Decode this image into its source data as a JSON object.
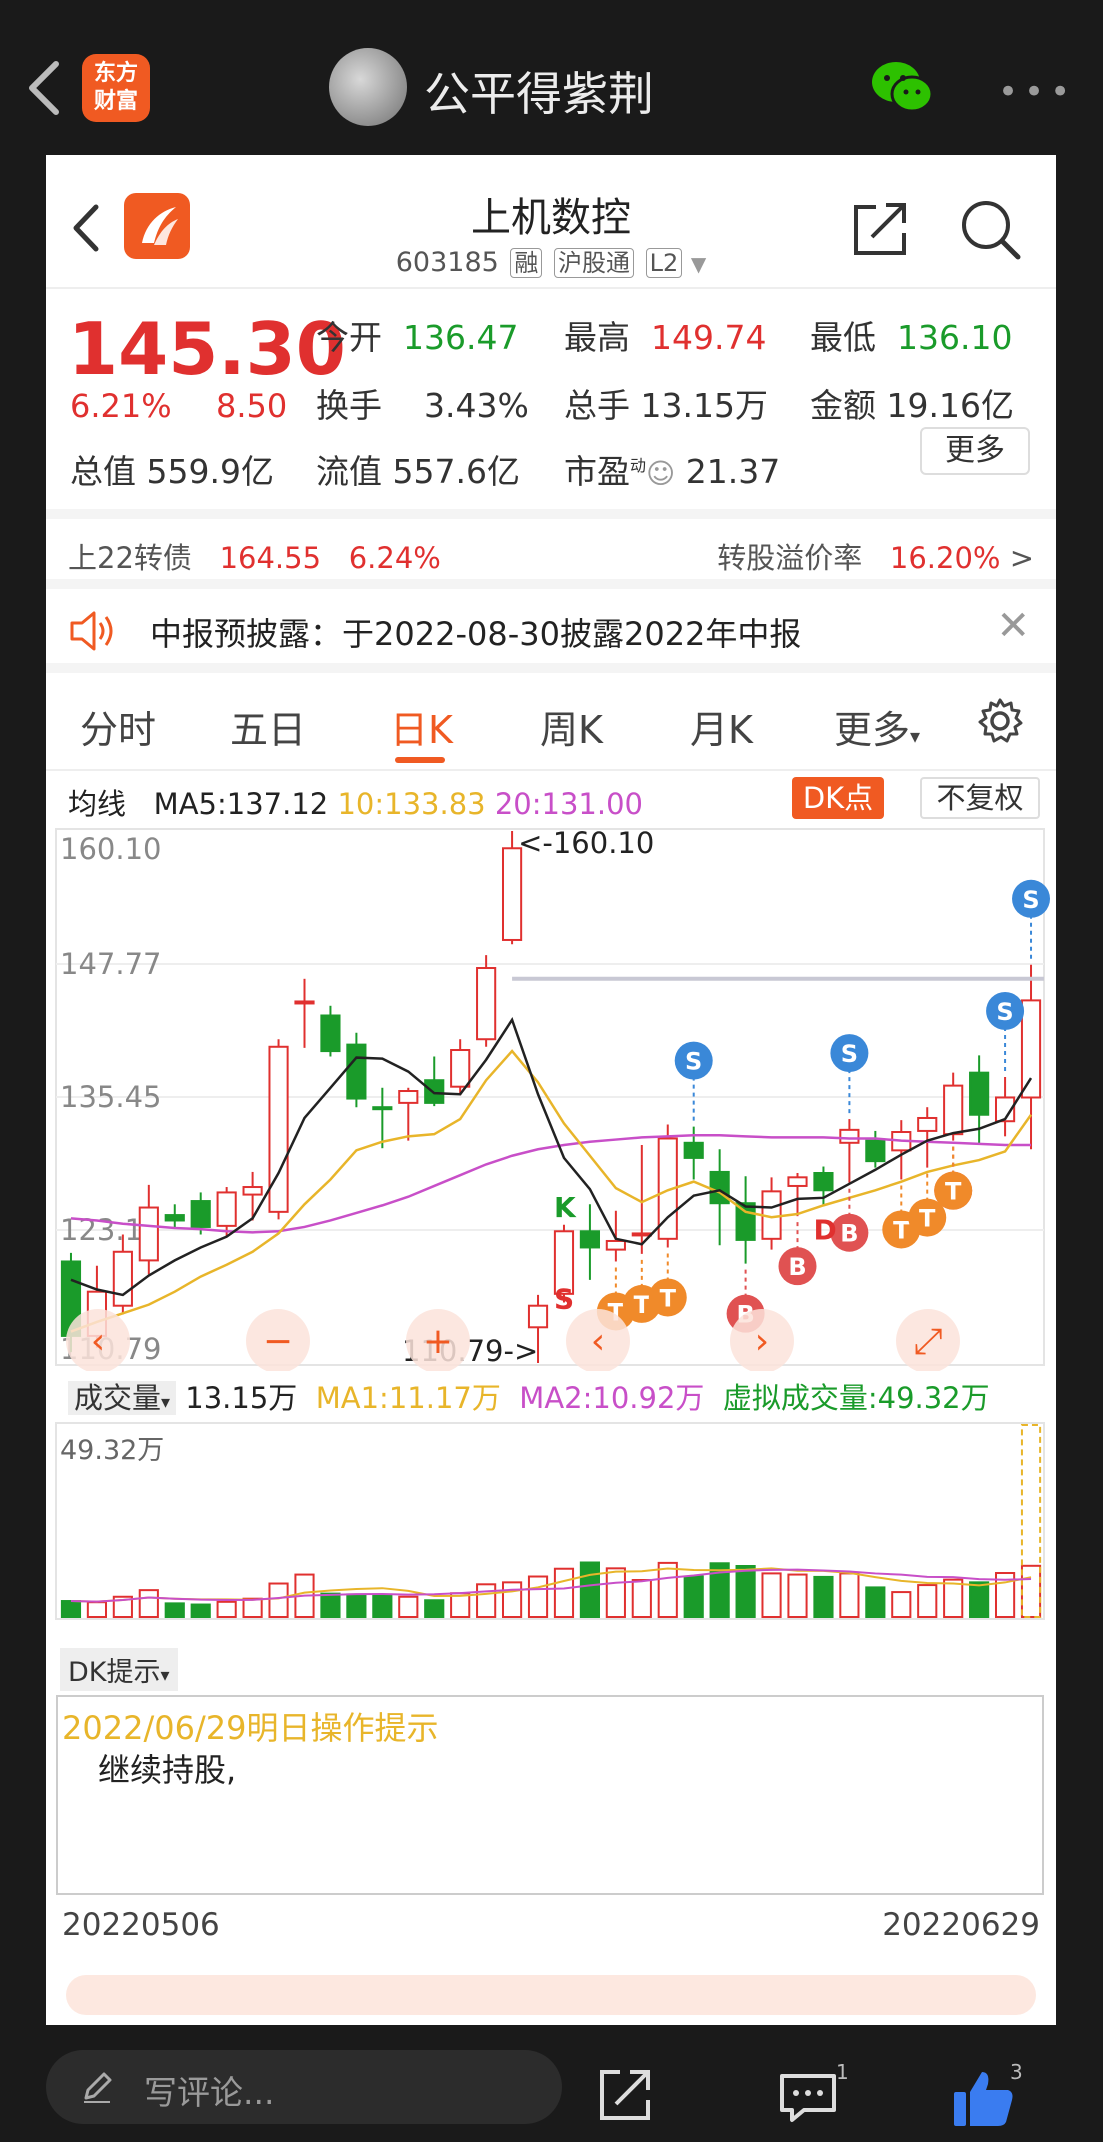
{
  "topbar": {
    "brand": "东方财富",
    "author": "公平得紫荆"
  },
  "header": {
    "stock_name": "上机数控",
    "code": "603185",
    "tags": [
      "融",
      "沪股通",
      "L2"
    ]
  },
  "quote": {
    "price": "145.30",
    "change_pct": "6.21%",
    "change": "8.50",
    "open_label": "今开",
    "open": "136.47",
    "high_label": "最高",
    "high": "149.74",
    "low_label": "最低",
    "low": "136.10",
    "turnover_label": "换手",
    "turnover": "3.43%",
    "volume_label": "总手",
    "volume": "13.15万",
    "amount_label": "金额",
    "amount": "19.16亿",
    "mcap_label": "总值",
    "mcap": "559.9亿",
    "float_label": "流值",
    "float": "557.6亿",
    "pe_label": "市盈",
    "pe_sup": "动",
    "pe": "21.37",
    "more": "更多"
  },
  "bond": {
    "name": "上22转债",
    "price": "164.55",
    "pct": "6.24%",
    "premium_label": "转股溢价率",
    "premium": "16.20%",
    "arrow": ">"
  },
  "notice": {
    "text": "中报预披露：于2022-08-30披露2022年中报"
  },
  "tabs": [
    "分时",
    "五日",
    "日K",
    "周K",
    "月K",
    "更多"
  ],
  "ma": {
    "label": "均线",
    "ma5": "MA5:137.12",
    "ma10": "10:133.83",
    "ma20": "20:131.00"
  },
  "buttons": {
    "dk": "DK点",
    "adjust": "不复权"
  },
  "colors": {
    "up": "#e0302f",
    "down": "#1a9b2a",
    "ma5": "#222222",
    "ma10": "#e8b52a",
    "ma20": "#c84fc8",
    "brand": "#f05a22"
  },
  "chart_data": {
    "type": "candlestick",
    "y_labels": [
      "160.10",
      "147.77",
      "135.45",
      "123.12",
      "110.79"
    ],
    "ylim": [
      110.79,
      160.1
    ],
    "high_annotation": "<-160.10",
    "low_annotation": "110.79->",
    "candles": [
      {
        "o": 120.2,
        "h": 121.0,
        "l": 111.8,
        "c": 113.3
      },
      {
        "o": 113.3,
        "h": 119.8,
        "l": 112.2,
        "c": 117.4
      },
      {
        "o": 116.1,
        "h": 122.7,
        "l": 115.3,
        "c": 121.1
      },
      {
        "o": 120.3,
        "h": 127.3,
        "l": 119.0,
        "c": 125.2
      },
      {
        "o": 124.5,
        "h": 125.5,
        "l": 123.3,
        "c": 124.0
      },
      {
        "o": 125.8,
        "h": 126.6,
        "l": 122.7,
        "c": 123.4
      },
      {
        "o": 123.5,
        "h": 127.1,
        "l": 122.5,
        "c": 126.6
      },
      {
        "o": 126.4,
        "h": 128.5,
        "l": 124.0,
        "c": 127.1
      },
      {
        "o": 124.8,
        "h": 140.8,
        "l": 124.1,
        "c": 140.1
      },
      {
        "o": 144.3,
        "h": 146.4,
        "l": 140.0,
        "c": 144.3
      },
      {
        "o": 143.0,
        "h": 143.9,
        "l": 139.2,
        "c": 139.7
      },
      {
        "o": 140.3,
        "h": 141.4,
        "l": 134.5,
        "c": 135.3
      },
      {
        "o": 134.5,
        "h": 136.3,
        "l": 130.7,
        "c": 134.4
      },
      {
        "o": 134.9,
        "h": 136.3,
        "l": 131.4,
        "c": 136.0
      },
      {
        "o": 137.0,
        "h": 139.2,
        "l": 134.6,
        "c": 134.9
      },
      {
        "o": 136.4,
        "h": 140.8,
        "l": 135.6,
        "c": 139.8
      },
      {
        "o": 140.8,
        "h": 148.6,
        "l": 140.1,
        "c": 147.4
      },
      {
        "o": 150.0,
        "h": 160.1,
        "l": 149.6,
        "c": 158.5
      },
      {
        "o": 114.1,
        "h": 117.1,
        "l": 110.79,
        "c": 116.1
      },
      {
        "o": 117.2,
        "h": 123.6,
        "l": 116.4,
        "c": 123.0
      },
      {
        "o": 123.0,
        "h": 125.5,
        "l": 118.5,
        "c": 121.5
      },
      {
        "o": 121.3,
        "h": 124.9,
        "l": 120.2,
        "c": 122.1
      },
      {
        "o": 122.7,
        "h": 131.0,
        "l": 120.9,
        "c": 122.8
      },
      {
        "o": 122.3,
        "h": 132.9,
        "l": 121.5,
        "c": 131.6
      },
      {
        "o": 131.2,
        "h": 132.7,
        "l": 127.8,
        "c": 129.8
      },
      {
        "o": 128.5,
        "h": 130.6,
        "l": 121.7,
        "c": 125.6
      },
      {
        "o": 125.6,
        "h": 128.1,
        "l": 120.0,
        "c": 122.2
      },
      {
        "o": 122.3,
        "h": 128.0,
        "l": 121.3,
        "c": 126.7
      },
      {
        "o": 127.2,
        "h": 128.4,
        "l": 124.4,
        "c": 128.0
      },
      {
        "o": 128.4,
        "h": 129.0,
        "l": 125.4,
        "c": 126.8
      },
      {
        "o": 131.2,
        "h": 133.4,
        "l": 127.5,
        "c": 132.4
      },
      {
        "o": 131.4,
        "h": 132.3,
        "l": 128.9,
        "c": 129.5
      },
      {
        "o": 130.5,
        "h": 133.3,
        "l": 127.8,
        "c": 132.2
      },
      {
        "o": 132.3,
        "h": 134.5,
        "l": 128.9,
        "c": 133.5
      },
      {
        "o": 132.0,
        "h": 137.7,
        "l": 131.4,
        "c": 136.5
      },
      {
        "o": 137.7,
        "h": 139.3,
        "l": 131.0,
        "c": 133.8
      },
      {
        "o": 133.2,
        "h": 137.3,
        "l": 131.8,
        "c": 135.4
      },
      {
        "o": 135.4,
        "h": 147.7,
        "l": 130.6,
        "c": 144.4
      }
    ],
    "ma5": [
      118.5,
      117.6,
      117.1,
      118.9,
      120.3,
      121.5,
      122.5,
      124.2,
      128.4,
      133.5,
      136.3,
      139.1,
      139.0,
      137.8,
      135.8,
      135.7,
      138.9,
      142.6,
      135.7,
      129.8,
      126.9,
      122.3,
      121.8,
      124.3,
      126.3,
      126.8,
      125.3,
      125.2,
      126.0,
      126.1,
      127.4,
      128.7,
      130.1,
      131.4,
      132.1,
      132.5,
      133.4,
      137.2
    ],
    "ma10": [
      113.7,
      114.6,
      115.4,
      116.2,
      117.4,
      118.8,
      119.9,
      121.1,
      122.8,
      125.5,
      127.8,
      130.5,
      131.3,
      131.8,
      132.0,
      133.4,
      137.0,
      139.7,
      136.8,
      133.0,
      130.0,
      127.0,
      125.7,
      126.8,
      127.6,
      126.6,
      124.8,
      124.3,
      124.6,
      125.4,
      126.1,
      126.8,
      127.6,
      128.5,
      129.1,
      129.6,
      130.4,
      133.8
    ],
    "ma20": [
      124.2,
      124.0,
      123.7,
      123.5,
      123.3,
      123.2,
      123.0,
      122.9,
      123.0,
      123.4,
      124.0,
      124.7,
      125.4,
      126.2,
      127.2,
      128.2,
      129.2,
      130.0,
      130.6,
      131.0,
      131.3,
      131.5,
      131.7,
      131.8,
      131.9,
      131.9,
      131.8,
      131.7,
      131.7,
      131.7,
      131.6,
      131.6,
      131.4,
      131.3,
      131.2,
      131.1,
      131.0,
      131.0
    ],
    "signals": [
      {
        "idx": 24,
        "type": "S"
      },
      {
        "idx": 30,
        "type": "S"
      },
      {
        "idx": 36,
        "type": "S"
      },
      {
        "idx": 37,
        "type": "S"
      },
      {
        "idx": 28,
        "type": "B"
      },
      {
        "idx": 30,
        "type": "B"
      },
      {
        "idx": 34,
        "type": "B"
      },
      {
        "idx": 26,
        "type": "B"
      },
      {
        "idx": 21,
        "type": "T"
      },
      {
        "idx": 22,
        "type": "T"
      },
      {
        "idx": 23,
        "type": "T"
      },
      {
        "idx": 32,
        "type": "T"
      },
      {
        "idx": 33,
        "type": "T"
      },
      {
        "idx": 34,
        "type": "T"
      }
    ],
    "letters": [
      {
        "idx": 19,
        "text": "K"
      },
      {
        "idx": 29,
        "text": "D"
      },
      {
        "idx": 19,
        "text": "S"
      }
    ]
  },
  "volume": {
    "selector": "成交量",
    "value": "13.15万",
    "ma1": "MA1:11.17万",
    "ma2": "MA2:10.92万",
    "virtual": "虚拟成交量:49.32万",
    "max_label": "49.32万",
    "bars": [
      4.1,
      3.8,
      5.2,
      6.9,
      3.5,
      3.2,
      3.9,
      4.7,
      8.6,
      10.9,
      6.0,
      5.8,
      5.7,
      5.2,
      4.3,
      6.1,
      8.4,
      8.9,
      10.4,
      12.4,
      14.0,
      12.5,
      9.5,
      13.9,
      10.4,
      13.8,
      13.1,
      11.2,
      10.9,
      10.3,
      11.2,
      7.6,
      6.4,
      8.2,
      9.6,
      8.9,
      11.3,
      13.15
    ],
    "virtual_vol": 49.32
  },
  "dk": {
    "selector": "DK提示",
    "date_text": "2022/06/29明日操作提示",
    "advice": "继续持股,"
  },
  "dates": {
    "start": "20220506",
    "end": "20220629"
  },
  "bottom": {
    "comment_placeholder": "写评论...",
    "msg_count": "1",
    "like_count": "3"
  }
}
